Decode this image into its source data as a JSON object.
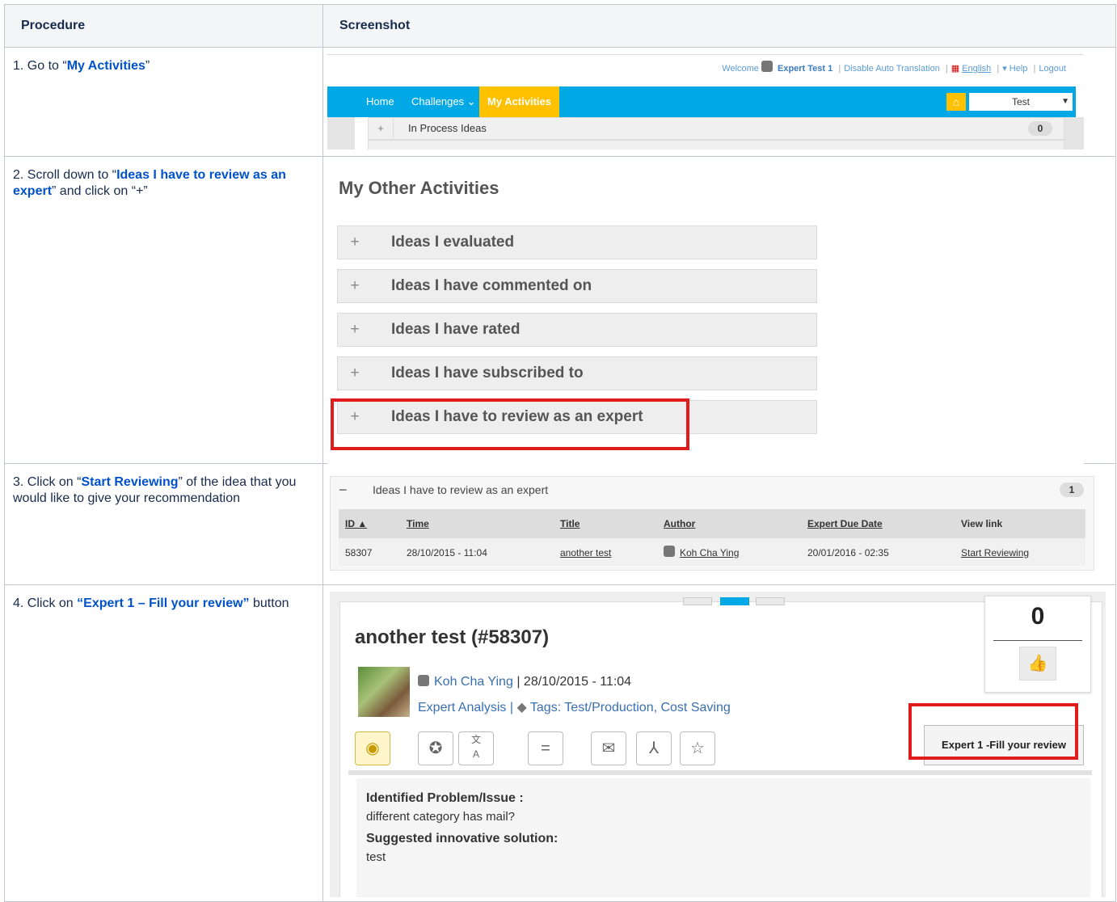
{
  "table": {
    "col_procedure": "Procedure",
    "col_screenshot": "Screenshot"
  },
  "steps": [
    {
      "pre": "1. Go to “",
      "link": "My Activities",
      "post": "”"
    },
    {
      "pre": "2. Scroll down to “",
      "link": "Ideas I have to review as an expert",
      "post": "” and click on “+”"
    },
    {
      "pre": "3. Click on “",
      "link": "Start Reviewing",
      "post": "” of the idea that you would like to give your recommendation"
    },
    {
      "pre": "4. Click on ",
      "link": "“Expert 1 – Fill your review”",
      "post": " button"
    }
  ],
  "shot1": {
    "welcome": "Welcome",
    "user": "Expert Test 1",
    "disable_translation": "Disable Auto Translation",
    "language": "English",
    "help": "▾ Help",
    "logout": "Logout",
    "nav_home": "Home",
    "nav_challenges": "Challenges ⌄",
    "nav_my_activities": "My Activities",
    "select_value": "Test",
    "in_process": "In Process Ideas",
    "in_process_count": "0"
  },
  "shot2": {
    "heading": "My Other Activities",
    "plus": "+",
    "items": [
      "Ideas I evaluated",
      "Ideas I have commented on",
      "Ideas I have rated",
      "Ideas I have subscribed to",
      "Ideas I have to review as an expert"
    ]
  },
  "shot3": {
    "minus": "−",
    "title": "Ideas I have to review as an expert",
    "count": "1",
    "headers": [
      "ID ▲",
      "Time",
      "Title",
      "Author",
      "Expert Due Date",
      "View link"
    ],
    "row": {
      "id": "58307",
      "time": "28/10/2015 - 11:04",
      "title": "another test",
      "author": "Koh Cha Ying",
      "due": "20/01/2016 - 02:35",
      "link": "Start Reviewing"
    }
  },
  "shot4": {
    "title": "another test (#58307)",
    "votes": "0",
    "author": "Koh Cha Ying",
    "date_sep": "|  28/10/2015 - 11:04",
    "analysis": "Expert Analysis |",
    "tags": "Tags: Test/Production, Cost Saving",
    "review_button": "Expert 1 -Fill your review",
    "problem_label": "Identified Problem/Issue :",
    "problem_text": "different category has mail?",
    "solution_label": "Suggested innovative solution:",
    "solution_text": "test"
  },
  "colors": {
    "nav": "#00a9e6",
    "active": "#ffc000",
    "highlight": "#e01c1c",
    "link": "#0052cc"
  }
}
